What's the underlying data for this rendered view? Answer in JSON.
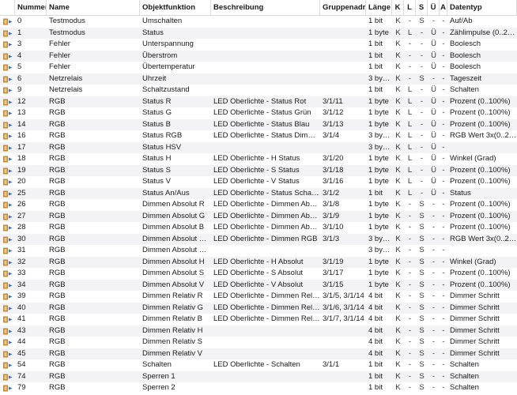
{
  "columns": [
    {
      "key": "icon",
      "label": ""
    },
    {
      "key": "nr",
      "label": "Nummer"
    },
    {
      "key": "name",
      "label": "Name"
    },
    {
      "key": "obj",
      "label": "Objektfunktion"
    },
    {
      "key": "desc",
      "label": "Beschreibung"
    },
    {
      "key": "ga",
      "label": "Gruppenadressen"
    },
    {
      "key": "len",
      "label": "Länge"
    },
    {
      "key": "k",
      "label": "K"
    },
    {
      "key": "l",
      "label": "L"
    },
    {
      "key": "s",
      "label": "S"
    },
    {
      "key": "u",
      "label": "Ü"
    },
    {
      "key": "a",
      "label": "A"
    },
    {
      "key": "dt",
      "label": "Datentyp"
    }
  ],
  "rows": [
    {
      "nr": "0",
      "name": "Testmodus",
      "obj": "Umschalten",
      "desc": "",
      "ga": "",
      "len": "1 bit",
      "k": "K",
      "l": "-",
      "s": "S",
      "u": "-",
      "a": "-",
      "dt": "Auf/Ab"
    },
    {
      "nr": "1",
      "name": "Testmodus",
      "obj": "Status",
      "desc": "",
      "ga": "",
      "len": "1 byte",
      "k": "K",
      "l": "L",
      "s": "-",
      "u": "Ü",
      "a": "-",
      "dt": "Zählimpulse (0..255)"
    },
    {
      "nr": "3",
      "name": "Fehler",
      "obj": "Unterspannung",
      "desc": "",
      "ga": "",
      "len": "1 bit",
      "k": "K",
      "l": "-",
      "s": "-",
      "u": "Ü",
      "a": "-",
      "dt": "Boolesch"
    },
    {
      "nr": "4",
      "name": "Fehler",
      "obj": "Überstrom",
      "desc": "",
      "ga": "",
      "len": "1 bit",
      "k": "K",
      "l": "-",
      "s": "-",
      "u": "Ü",
      "a": "-",
      "dt": "Boolesch"
    },
    {
      "nr": "5",
      "name": "Fehler",
      "obj": "Übertemperatur",
      "desc": "",
      "ga": "",
      "len": "1 bit",
      "k": "K",
      "l": "-",
      "s": "-",
      "u": "Ü",
      "a": "-",
      "dt": "Boolesch"
    },
    {
      "nr": "6",
      "name": "Netzrelais",
      "obj": "Uhrzeit",
      "desc": "",
      "ga": "",
      "len": "3 bytes",
      "k": "K",
      "l": "-",
      "s": "S",
      "u": "-",
      "a": "-",
      "dt": "Tageszeit"
    },
    {
      "nr": "9",
      "name": "Netzrelais",
      "obj": "Schaltzustand",
      "desc": "",
      "ga": "",
      "len": "1 bit",
      "k": "K",
      "l": "L",
      "s": "-",
      "u": "Ü",
      "a": "-",
      "dt": "Schalten"
    },
    {
      "nr": "12",
      "name": "RGB",
      "obj": "Status R",
      "desc": "LED Oberlichte - Status Rot",
      "ga": "3/1/11",
      "len": "1 byte",
      "k": "K",
      "l": "L",
      "s": "-",
      "u": "Ü",
      "a": "-",
      "dt": "Prozent (0..100%)"
    },
    {
      "nr": "13",
      "name": "RGB",
      "obj": "Status G",
      "desc": "LED Oberlichte - Status Grün",
      "ga": "3/1/12",
      "len": "1 byte",
      "k": "K",
      "l": "L",
      "s": "-",
      "u": "Ü",
      "a": "-",
      "dt": "Prozent (0..100%)"
    },
    {
      "nr": "14",
      "name": "RGB",
      "obj": "Status B",
      "desc": "LED Oberlichte - Status Blau",
      "ga": "3/1/13",
      "len": "1 byte",
      "k": "K",
      "l": "L",
      "s": "-",
      "u": "Ü",
      "a": "-",
      "dt": "Prozent (0..100%)"
    },
    {
      "nr": "16",
      "name": "RGB",
      "obj": "Status RGB",
      "desc": "LED Oberlichte - Status Dimmen R...",
      "ga": "3/1/4",
      "len": "3 bytes",
      "k": "K",
      "l": "L",
      "s": "-",
      "u": "Ü",
      "a": "-",
      "dt": "RGB Wert 3x(0..255)"
    },
    {
      "nr": "17",
      "name": "RGB",
      "obj": "Status HSV",
      "desc": "",
      "ga": "",
      "len": "3 bytes",
      "k": "K",
      "l": "L",
      "s": "-",
      "u": "Ü",
      "a": "-",
      "dt": ""
    },
    {
      "nr": "18",
      "name": "RGB",
      "obj": "Status H",
      "desc": "LED Oberlichte - H Status",
      "ga": "3/1/20",
      "len": "1 byte",
      "k": "K",
      "l": "L",
      "s": "-",
      "u": "Ü",
      "a": "-",
      "dt": "Winkel (Grad)"
    },
    {
      "nr": "19",
      "name": "RGB",
      "obj": "Status S",
      "desc": "LED Oberlichte - S Status",
      "ga": "3/1/18",
      "len": "1 byte",
      "k": "K",
      "l": "L",
      "s": "-",
      "u": "Ü",
      "a": "-",
      "dt": "Prozent (0..100%)"
    },
    {
      "nr": "20",
      "name": "RGB",
      "obj": "Status V",
      "desc": "LED Oberlichte - V Status",
      "ga": "3/1/16",
      "len": "1 byte",
      "k": "K",
      "l": "L",
      "s": "-",
      "u": "Ü",
      "a": "-",
      "dt": "Prozent (0..100%)"
    },
    {
      "nr": "25",
      "name": "RGB",
      "obj": "Status An/Aus",
      "desc": "LED Oberlichte - Status Schalten",
      "ga": "3/1/2",
      "len": "1 bit",
      "k": "K",
      "l": "L",
      "s": "-",
      "u": "Ü",
      "a": "-",
      "dt": "Status"
    },
    {
      "nr": "26",
      "name": "RGB",
      "obj": "Dimmen Absolut R",
      "desc": "LED Oberlichte - Dimmen Absolut...",
      "ga": "3/1/8",
      "len": "1 byte",
      "k": "K",
      "l": "-",
      "s": "S",
      "u": "-",
      "a": "-",
      "dt": "Prozent (0..100%)"
    },
    {
      "nr": "27",
      "name": "RGB",
      "obj": "Dimmen Absolut G",
      "desc": "LED Oberlichte - Dimmen Absolut...",
      "ga": "3/1/9",
      "len": "1 byte",
      "k": "K",
      "l": "-",
      "s": "S",
      "u": "-",
      "a": "-",
      "dt": "Prozent (0..100%)"
    },
    {
      "nr": "28",
      "name": "RGB",
      "obj": "Dimmen Absolut B",
      "desc": "LED Oberlichte - Dimmen Absolut...",
      "ga": "3/1/10",
      "len": "1 byte",
      "k": "K",
      "l": "-",
      "s": "S",
      "u": "-",
      "a": "-",
      "dt": "Prozent (0..100%)"
    },
    {
      "nr": "30",
      "name": "RGB",
      "obj": "Dimmen Absolut RGB",
      "desc": "LED Oberlichte - Dimmen RGB",
      "ga": "3/1/3",
      "len": "3 bytes",
      "k": "K",
      "l": "-",
      "s": "S",
      "u": "-",
      "a": "-",
      "dt": "RGB Wert 3x(0..255)"
    },
    {
      "nr": "31",
      "name": "RGB",
      "obj": "Dimmen Absolut HSV",
      "desc": "",
      "ga": "",
      "len": "3 bytes",
      "k": "K",
      "l": "-",
      "s": "S",
      "u": "-",
      "a": "-",
      "dt": ""
    },
    {
      "nr": "32",
      "name": "RGB",
      "obj": "Dimmen Absolut H",
      "desc": "LED Oberlichte - H Absolut",
      "ga": "3/1/19",
      "len": "1 byte",
      "k": "K",
      "l": "-",
      "s": "S",
      "u": "-",
      "a": "-",
      "dt": "Winkel (Grad)"
    },
    {
      "nr": "33",
      "name": "RGB",
      "obj": "Dimmen Absolut S",
      "desc": "LED Oberlichte - S Absolut",
      "ga": "3/1/17",
      "len": "1 byte",
      "k": "K",
      "l": "-",
      "s": "S",
      "u": "-",
      "a": "-",
      "dt": "Prozent (0..100%)"
    },
    {
      "nr": "34",
      "name": "RGB",
      "obj": "Dimmen Absolut V",
      "desc": "LED Oberlichte - V Absolut",
      "ga": "3/1/15",
      "len": "1 byte",
      "k": "K",
      "l": "-",
      "s": "S",
      "u": "-",
      "a": "-",
      "dt": "Prozent (0..100%)"
    },
    {
      "nr": "39",
      "name": "RGB",
      "obj": "Dimmen Relativ R",
      "desc": "LED Oberlichte - Dimmen Relativ Rot",
      "ga": "3/1/5, 3/1/14",
      "len": "4 bit",
      "k": "K",
      "l": "-",
      "s": "S",
      "u": "-",
      "a": "-",
      "dt": "Dimmer Schritt"
    },
    {
      "nr": "40",
      "name": "RGB",
      "obj": "Dimmen Relativ G",
      "desc": "LED Oberlichte - Dimmen Relativ G...",
      "ga": "3/1/6, 3/1/14",
      "len": "4 bit",
      "k": "K",
      "l": "-",
      "s": "S",
      "u": "-",
      "a": "-",
      "dt": "Dimmer Schritt"
    },
    {
      "nr": "41",
      "name": "RGB",
      "obj": "Dimmen Relativ B",
      "desc": "LED Oberlichte - Dimmen Relativ Bl...",
      "ga": "3/1/7, 3/1/14",
      "len": "4 bit",
      "k": "K",
      "l": "-",
      "s": "S",
      "u": "-",
      "a": "-",
      "dt": "Dimmer Schritt"
    },
    {
      "nr": "43",
      "name": "RGB",
      "obj": "Dimmen Relativ H",
      "desc": "",
      "ga": "",
      "len": "4 bit",
      "k": "K",
      "l": "-",
      "s": "S",
      "u": "-",
      "a": "-",
      "dt": "Dimmer Schritt"
    },
    {
      "nr": "44",
      "name": "RGB",
      "obj": "Dimmen Relativ S",
      "desc": "",
      "ga": "",
      "len": "4 bit",
      "k": "K",
      "l": "-",
      "s": "S",
      "u": "-",
      "a": "-",
      "dt": "Dimmer Schritt"
    },
    {
      "nr": "45",
      "name": "RGB",
      "obj": "Dimmen Relativ V",
      "desc": "",
      "ga": "",
      "len": "4 bit",
      "k": "K",
      "l": "-",
      "s": "S",
      "u": "-",
      "a": "-",
      "dt": "Dimmer Schritt"
    },
    {
      "nr": "54",
      "name": "RGB",
      "obj": "Schalten",
      "desc": "LED Oberlichte - Schalten",
      "ga": "3/1/1",
      "len": "1 bit",
      "k": "K",
      "l": "-",
      "s": "S",
      "u": "-",
      "a": "-",
      "dt": "Schalten"
    },
    {
      "nr": "74",
      "name": "RGB",
      "obj": "Sperren 1",
      "desc": "",
      "ga": "",
      "len": "1 bit",
      "k": "K",
      "l": "-",
      "s": "S",
      "u": "-",
      "a": "-",
      "dt": "Schalten"
    },
    {
      "nr": "79",
      "name": "RGB",
      "obj": "Sperren 2",
      "desc": "",
      "ga": "",
      "len": "1 bit",
      "k": "K",
      "l": "-",
      "s": "S",
      "u": "-",
      "a": "-",
      "dt": "Schalten"
    }
  ],
  "colors": {
    "icon_body": "#c08a3e",
    "icon_arrow": "#3a6fc9",
    "alt_row": "#f3f3f5"
  },
  "icon": "knx-communication-object-icon"
}
